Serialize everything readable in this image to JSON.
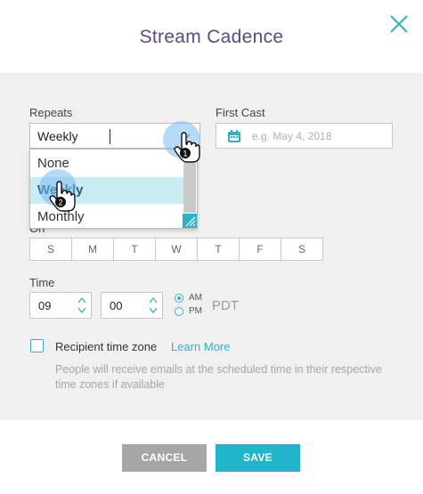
{
  "dialog": {
    "title": "Stream Cadence",
    "close_icon": "close-icon"
  },
  "repeats": {
    "label": "Repeats",
    "value": "Weekly",
    "options": [
      "None",
      "Weekly",
      "Monthly"
    ]
  },
  "first_cast": {
    "label": "First Cast",
    "placeholder": "e.g. May 4, 2018",
    "icon": "calendar-icon"
  },
  "on": {
    "label": "On",
    "days": [
      "S",
      "M",
      "T",
      "W",
      "T",
      "F",
      "S"
    ]
  },
  "time": {
    "label": "Time",
    "hour": "09",
    "minute": "00",
    "am_label": "AM",
    "pm_label": "PM",
    "selected_period": "AM",
    "timezone": "PDT"
  },
  "recipient_tz": {
    "label": "Recipient time zone",
    "link": "Learn More",
    "help": "People will receive emails at the scheduled time in their respective time zones if available",
    "checked": false
  },
  "footer": {
    "cancel_label": "CANCEL",
    "save_label": "SAVE"
  },
  "tap_markers": [
    "1",
    "2"
  ],
  "colors": {
    "accent": "#1fb6cc",
    "title": "#5a4a86",
    "selected_option_bg": "#c9ecf3"
  }
}
